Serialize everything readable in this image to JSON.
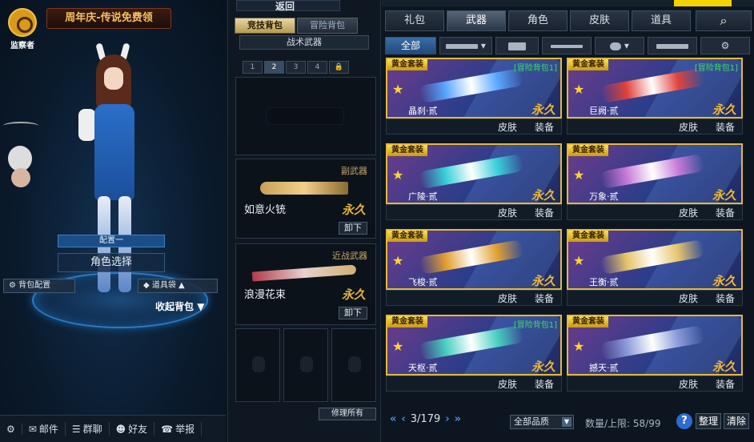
{
  "left": {
    "logo_text": "监察者",
    "banner": "周年庆-传说免费领",
    "config_slot": "配置一",
    "role_select": "角色选择",
    "bag_config": "背包配置",
    "tool_bag": "道具袋",
    "collapse_bag": "收起背包",
    "bottom": [
      "邮件",
      "群聊",
      "好友",
      "举报"
    ]
  },
  "mid": {
    "back_label": "返回",
    "tabs": [
      "竞技背包",
      "冒险背包"
    ],
    "tactical": "战术武器",
    "slots": [
      "1",
      "2",
      "3",
      "4"
    ],
    "secondary": {
      "label": "副武器",
      "name": "如意火铳",
      "perm": "永久",
      "unload": "卸下"
    },
    "melee": {
      "label": "近战武器",
      "name": "浪漫花束",
      "perm": "永久",
      "unload": "卸下"
    },
    "repair": "修理所有"
  },
  "right": {
    "tabs": [
      "礼包",
      "武器",
      "角色",
      "皮肤",
      "道具"
    ],
    "active_tab": "武器",
    "filter_all": "全部",
    "cards": [
      {
        "tag": "黄金套装",
        "adv": "[冒险背包1]",
        "name": "晶刹·贰",
        "perm": "永久",
        "skin": "皮肤",
        "equip": "装备",
        "color": "#5aa7ff"
      },
      {
        "tag": "黄金套装",
        "adv": "[冒险背包1]",
        "name": "巨阙·贰",
        "perm": "永久",
        "skin": "皮肤",
        "equip": "装备",
        "color": "#e0423a"
      },
      {
        "tag": "黄金套装",
        "adv": "",
        "name": "广陵·贰",
        "perm": "永久",
        "skin": "皮肤",
        "equip": "装备",
        "color": "#3ad0d8"
      },
      {
        "tag": "黄金套装",
        "adv": "",
        "name": "万象·贰",
        "perm": "永久",
        "skin": "皮肤",
        "equip": "装备",
        "color": "#c87ad8"
      },
      {
        "tag": "黄金套装",
        "adv": "",
        "name": "飞梭·贰",
        "perm": "永久",
        "skin": "皮肤",
        "equip": "装备",
        "color": "#e0a030"
      },
      {
        "tag": "黄金套装",
        "adv": "",
        "name": "王衡·贰",
        "perm": "永久",
        "skin": "皮肤",
        "equip": "装备",
        "color": "#e6c46a"
      },
      {
        "tag": "黄金套装",
        "adv": "[冒险背包1]",
        "name": "天枢·贰",
        "perm": "永久",
        "skin": "皮肤",
        "equip": "装备",
        "color": "#4ad0c0"
      },
      {
        "tag": "黄金套装",
        "adv": "",
        "name": "撼天·贰",
        "perm": "永久",
        "skin": "皮肤",
        "equip": "装备",
        "color": "#8a9ad8"
      }
    ],
    "page": "3/179",
    "quality": "全部品质",
    "capacity": "数量/上限: 58/99",
    "help": "?",
    "sort": "整理",
    "clear": "清除"
  }
}
